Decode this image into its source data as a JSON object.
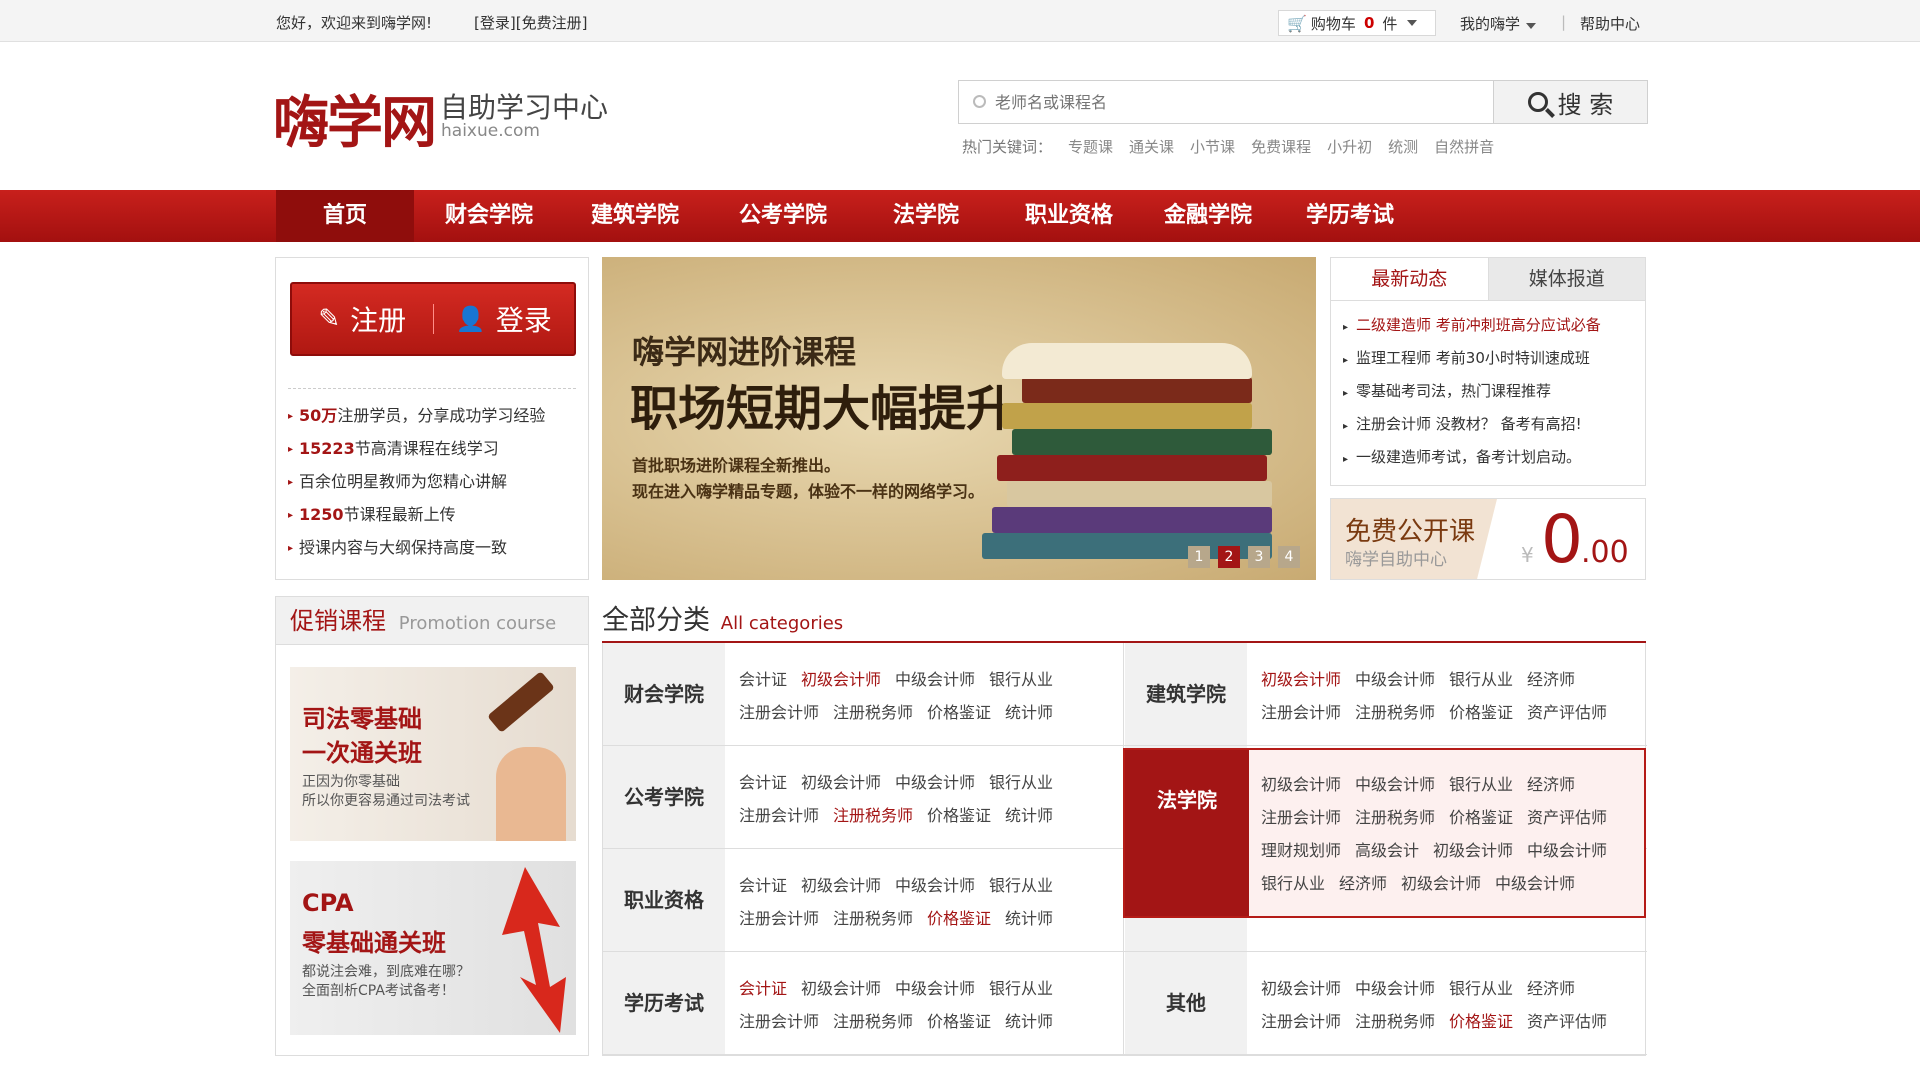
{
  "topbar": {
    "welcome": "您好，欢迎来到嗨学网!",
    "login": "[登录]",
    "register": "[免费注册]",
    "cart_label": "购物车",
    "cart_count": "0",
    "cart_unit": "件",
    "my_account": "我的嗨学",
    "help": "帮助中心"
  },
  "header": {
    "logo_main": "嗨学网",
    "logo_sub": "自助学习中心",
    "logo_en": "haixue.com",
    "search_placeholder": "老师名或课程名",
    "search_button": "搜 索",
    "hot_label": "热门关键词：",
    "hot_words": [
      "专题课",
      "通关课",
      "小节课",
      "免费课程",
      "小升初",
      "统测",
      "自然拼音"
    ]
  },
  "nav": {
    "items": [
      "首页",
      "财会学院",
      "建筑学院",
      "公考学院",
      "法学院",
      "职业资格",
      "金融学院",
      "学历考试"
    ]
  },
  "auth_box": {
    "register": "注册",
    "login": "登录",
    "stats": [
      {
        "bold": "50万",
        "text": "注册学员，分享成功学习经验"
      },
      {
        "bold": "15223",
        "text": "节高清课程在线学习"
      },
      {
        "bold": "",
        "text": "百余位明星教师为您精心讲解"
      },
      {
        "bold": "1250",
        "text": "节课程最新上传"
      },
      {
        "bold": "",
        "text": "授课内容与大纲保持高度一致"
      }
    ]
  },
  "banner": {
    "title1": "嗨学网进阶课程",
    "title2": "职场短期大幅提升",
    "desc1": "首批职场进阶课程全新推出。",
    "desc2": "现在进入嗨学精品专题，体验不一样的网络学习。",
    "pages": [
      "1",
      "2",
      "3",
      "4"
    ],
    "active_page": "2"
  },
  "news": {
    "tab_active": "最新动态",
    "tab_other": "媒体报道",
    "items": [
      "二级建造师 考前冲刺班高分应试必备",
      "监理工程师 考前30小时特训速成班",
      "零基础考司法，热门课程推荐",
      "注册会计师 没教材？ 备考有高招!",
      "一级建造师考试，备考计划启动。"
    ]
  },
  "free_course": {
    "title": "免费公开课",
    "subtitle": "嗨学自助中心",
    "currency": "¥",
    "price": "0",
    "cents": ".00"
  },
  "promo": {
    "title_cn": "促销课程",
    "title_en": "Promotion course",
    "card1": {
      "line1": "司法零基础",
      "line2": "一次通关班",
      "desc1": "正因为你零基础",
      "desc2": "所以你更容易通过司法考试"
    },
    "card2": {
      "line1": "CPA",
      "line2": "零基础通关班",
      "desc1": "都说注会难，到底难在哪？",
      "desc2": "全面剖析CPA考试备考！"
    }
  },
  "categories": {
    "title_cn": "全部分类",
    "title_en": "All categories",
    "rows": [
      {
        "name": "财会学院",
        "links": [
          "会计证",
          "初级会计师",
          "中级会计师",
          "银行从业",
          "注册会计师",
          "注册税务师",
          "价格鉴证",
          "统计师"
        ],
        "red": [
          1
        ]
      },
      {
        "name": "建筑学院",
        "links": [
          "初级会计师",
          "中级会计师",
          "银行从业",
          "经济师",
          "注册会计师",
          "注册税务师",
          "价格鉴证",
          "资产评估师"
        ],
        "red": [
          0
        ]
      },
      {
        "name": "公考学院",
        "links": [
          "会计证",
          "初级会计师",
          "中级会计师",
          "银行从业",
          "注册会计师",
          "注册税务师",
          "价格鉴证",
          "统计师"
        ],
        "red": [
          5
        ]
      },
      {
        "name": "法学院",
        "links": [],
        "red": []
      },
      {
        "name": "职业资格",
        "links": [
          "会计证",
          "初级会计师",
          "中级会计师",
          "银行从业",
          "注册会计师",
          "注册税务师",
          "价格鉴证",
          "统计师"
        ],
        "red": [
          6
        ]
      },
      {
        "name": "",
        "links": [
          "注册会计师",
          "注册税务师",
          "价格鉴证",
          "资产评估师"
        ],
        "red": []
      },
      {
        "name": "学历考试",
        "links": [
          "会计证",
          "初级会计师",
          "中级会计师",
          "银行从业",
          "注册会计师",
          "注册税务师",
          "价格鉴证",
          "统计师"
        ],
        "red": [
          0
        ]
      },
      {
        "name": "其他",
        "links": [
          "初级会计师",
          "中级会计师",
          "银行从业",
          "经济师",
          "注册会计师",
          "注册税务师",
          "价格鉴证",
          "资产评估师"
        ],
        "red": [
          6
        ]
      }
    ],
    "popup": {
      "name": "法学院",
      "links": [
        "初级会计师",
        "中级会计师",
        "银行从业",
        "经济师",
        "注册会计师",
        "注册税务师",
        "价格鉴证",
        "资产评估师",
        "理财规划师",
        "高级会计",
        "初级会计师",
        "中级会计师",
        "银行从业",
        "经济师",
        "初级会计师",
        "中级会计师"
      ]
    }
  },
  "colors": {
    "brand_red": "#a31515",
    "nav_red": "#c8201c"
  }
}
